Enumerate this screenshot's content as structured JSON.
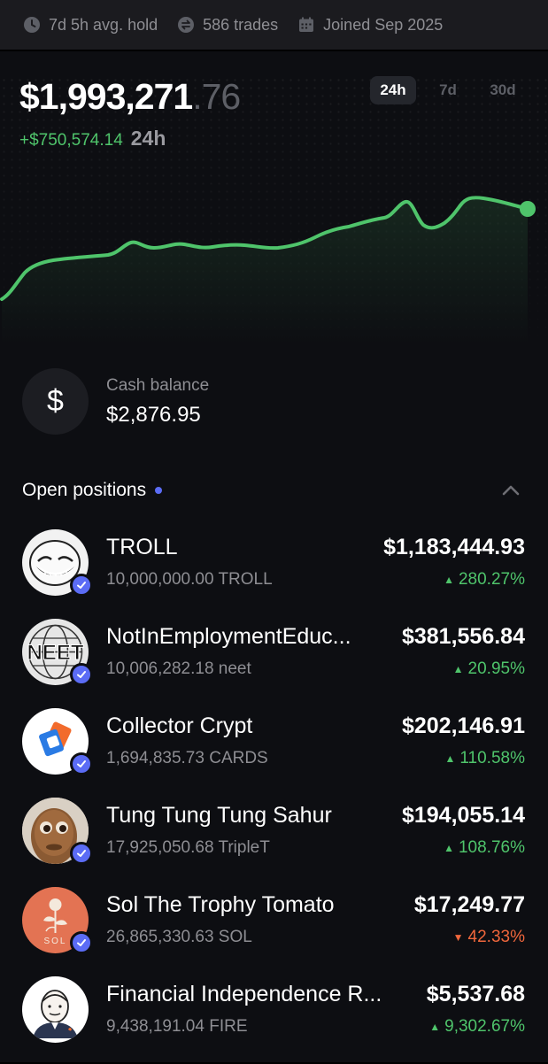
{
  "stats": {
    "avg_hold": "7d 5h avg. hold",
    "trades": "586 trades",
    "joined": "Joined Sep 2025"
  },
  "portfolio": {
    "value_main": "$1,993,271",
    "value_cents": ".76",
    "change": "+$750,574.14",
    "change_period": "24h",
    "tabs": [
      "24h",
      "7d",
      "30d"
    ],
    "active_tab": "24h",
    "line_color": "#4fc46b"
  },
  "cash": {
    "icon_symbol": "$",
    "label": "Cash balance",
    "value": "$2,876.95"
  },
  "positions": {
    "title": "Open positions",
    "items": [
      {
        "name": "TROLL",
        "amount": "10,000,000.00 TROLL",
        "value": "$1,183,444.93",
        "change": "280.27%",
        "direction": "up",
        "avatar_label": ""
      },
      {
        "name": "NotInEmploymentEduc...",
        "amount": "10,006,282.18 neet",
        "value": "$381,556.84",
        "change": "20.95%",
        "direction": "up",
        "avatar_label": "NEET"
      },
      {
        "name": "Collector Crypt",
        "amount": "1,694,835.73 CARDS",
        "value": "$202,146.91",
        "change": "110.58%",
        "direction": "up",
        "avatar_label": ""
      },
      {
        "name": "Tung Tung Tung Sahur",
        "amount": "17,925,050.68 TripleT",
        "value": "$194,055.14",
        "change": "108.76%",
        "direction": "up",
        "avatar_label": ""
      },
      {
        "name": "Sol The Trophy Tomato",
        "amount": "26,865,330.63 SOL",
        "value": "$17,249.77",
        "change": "42.33%",
        "direction": "down",
        "avatar_label": "SOL"
      },
      {
        "name": "Financial Independence R...",
        "amount": "9,438,191.04 FIRE",
        "value": "$5,537.68",
        "change": "9,302.67%",
        "direction": "up",
        "avatar_label": ""
      }
    ]
  },
  "colors": {
    "up": "#4fc46b",
    "down": "#f0673c",
    "accent": "#5b6cf5"
  }
}
